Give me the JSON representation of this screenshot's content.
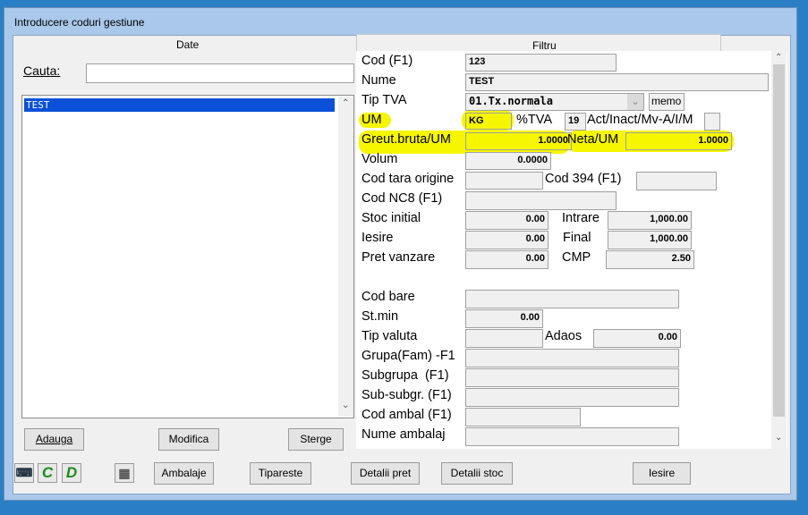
{
  "window": {
    "title": "Introducere coduri gestiune"
  },
  "tabs": {
    "date": "Date",
    "filtru": "Filtru"
  },
  "search": {
    "label": "Cauta:",
    "value": ""
  },
  "list": {
    "items": [
      "TEST"
    ]
  },
  "form": {
    "cod_label": "Cod (F1)",
    "cod_value": "123",
    "nume_label": "Nume",
    "nume_value": "TEST",
    "tip_tva_label": "Tip TVA",
    "tip_tva_value": "01.Tx.normala",
    "memo_label": "memo",
    "um_label": "UM",
    "um_value": "KG",
    "tva_pct_label": "%TVA",
    "tva_pct_value": "19",
    "act_label": "Act/Inact/Mv-A/I/M",
    "act_value": "",
    "greut_label": "Greut.bruta/UM",
    "greut_value": "1.0000",
    "neta_label": "Neta/UM",
    "neta_value": "1.0000",
    "volum_label": "Volum",
    "volum_value": "0.0000",
    "tara_label": "Cod tara origine",
    "tara_value": "",
    "cod394_label": "Cod 394 (F1)",
    "cod394_value": "",
    "nc8_label": "Cod NC8 (F1)",
    "nc8_value": "",
    "stoc_initial_label": "Stoc initial",
    "stoc_initial_value": "0.00",
    "intrare_label": "Intrare",
    "intrare_value": "1,000.00",
    "iesire_label": "Iesire",
    "iesire_value": "0.00",
    "final_label": "Final",
    "final_value": "1,000.00",
    "pret_label": "Pret vanzare",
    "pret_value": "0.00",
    "cmp_label": "CMP",
    "cmp_value": "2.50",
    "cod_bare_label": "Cod bare",
    "cod_bare_value": "",
    "stmin_label": "St.min",
    "stmin_value": "0.00",
    "valuta_label": "Tip valuta",
    "valuta_value": "",
    "adaos_label": "Adaos",
    "adaos_value": "0.00",
    "grupa_label": "Grupa(Fam) -F1",
    "grupa_value": "",
    "subgrupa_label": "Subgrupa  (F1)",
    "subgrupa_value": "",
    "subsubgr_label": "Sub-subgr. (F1)",
    "subsubgr_value": "",
    "ambal_label": "Cod ambal (F1)",
    "ambal_value": "",
    "nume_ambal_label": "Nume ambalaj",
    "nume_ambal_value": ""
  },
  "buttons": {
    "adauga": "Adauga",
    "modifica": "Modifica",
    "sterge": "Sterge",
    "ambalaje": "Ambalaje",
    "tipareste": "Tipareste",
    "detalii_pret": "Detalii pret",
    "detalii_stoc": "Detalii stoc",
    "iesire": "Iesire",
    "c": "C",
    "d": "D"
  },
  "icons": [
    "keyboard-icon",
    "package-icon"
  ],
  "colors": {
    "highlight": "#f6f600",
    "selection": "#0a50d8"
  }
}
